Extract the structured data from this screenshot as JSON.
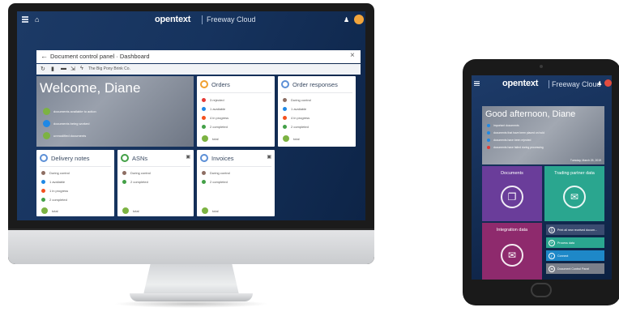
{
  "desktop": {
    "topbar": {
      "brand": "opentext",
      "product": "Freeway Cloud"
    },
    "window": {
      "back_glyph": "←",
      "title": "Document control panel · Dashboard",
      "close_glyph": "×",
      "toolbar_icons": [
        "refresh-icon",
        "trash-icon",
        "print-icon",
        "export-icon",
        "lightning-icon"
      ],
      "breadcrumb": "The Big Pony Brink Co."
    },
    "welcome": {
      "heading": "Welcome, Diane",
      "items": [
        {
          "count": "12",
          "text": "documents available to action",
          "color": "#7cb342"
        },
        {
          "count": "1",
          "text": "documents being worked",
          "color": "#1e88e5"
        },
        {
          "count": "15",
          "text": "unmodified documents",
          "color": "#7cb342"
        }
      ]
    },
    "cards": {
      "orders": {
        "label": "Orders",
        "icon_color": "#f0a030",
        "rows": [
          {
            "text": "3 rejected",
            "color": "#e53935"
          },
          {
            "text": "1 available",
            "color": "#1e88e5"
          },
          {
            "text": "4 in progress",
            "color": "#f4511e"
          },
          {
            "text": "2 completed",
            "color": "#43a047"
          }
        ],
        "total": "total"
      },
      "order_responses": {
        "label": "Order responses",
        "icon_color": "#5c8fd6",
        "rows": [
          {
            "text": "During control",
            "color": "#8d6e63"
          },
          {
            "text": "1 available",
            "color": "#1e88e5"
          },
          {
            "text": "4 in progress",
            "color": "#f4511e"
          },
          {
            "text": "2 completed",
            "color": "#43a047"
          }
        ],
        "total": "total"
      },
      "delivery_notes": {
        "label": "Delivery notes",
        "icon_color": "#5c8fd6",
        "rows": [
          {
            "text": "During control",
            "color": "#8d6e63"
          },
          {
            "text": "1 available",
            "color": "#1e88e5"
          },
          {
            "text": "1 in progress",
            "color": "#f4511e"
          },
          {
            "text": "2 completed",
            "color": "#43a047"
          }
        ],
        "total": "total"
      },
      "asns": {
        "label": "ASNs",
        "icon_color": "#43a047",
        "rows": [
          {
            "text": "During control",
            "color": "#8d6e63"
          },
          {
            "text": "2 completed",
            "color": "#43a047"
          }
        ],
        "total": "total"
      },
      "invoices": {
        "label": "Invoices",
        "icon_color": "#5c8fd6",
        "rows": [
          {
            "text": "During control",
            "color": "#8d6e63"
          },
          {
            "text": "2 completed",
            "color": "#43a047"
          }
        ],
        "total": "total"
      }
    }
  },
  "tablet": {
    "topbar": {
      "brand": "opentext",
      "product": "Freeway Cloud"
    },
    "greeting": {
      "heading": "Good afternoon, Diane",
      "items": [
        {
          "text": "important documents",
          "color": "#1e88e5"
        },
        {
          "text": "documents that have been placed on hold",
          "color": "#1e88e5"
        },
        {
          "text": "documents have been rejected",
          "color": "#1e88e5"
        },
        {
          "text": "documents have failed during processing",
          "color": "#e53935"
        }
      ],
      "date": "Tuesday, March 25, 2019"
    },
    "tiles": {
      "documents": {
        "label": "Documents",
        "color": "#6a3d9a",
        "glyph": "❐"
      },
      "trading_partner": {
        "label": "Trading partner data",
        "color": "#2aa68f",
        "glyph": "✉"
      },
      "integration": {
        "label": "Integration data",
        "color": "#8e2a6d",
        "glyph": "✉"
      }
    },
    "actions": [
      {
        "label": "Print all new received docum...",
        "glyph": "⎙",
        "color": "#3a4b70"
      },
      {
        "label": "Process data",
        "glyph": "⟳",
        "color": "#2aa68f"
      },
      {
        "label": "Connect",
        "glyph": "ƒ",
        "color": "#1e88c8"
      },
      {
        "label": "Document Control Panel",
        "glyph": "⇆",
        "color": "#7a7f8a"
      }
    ]
  }
}
